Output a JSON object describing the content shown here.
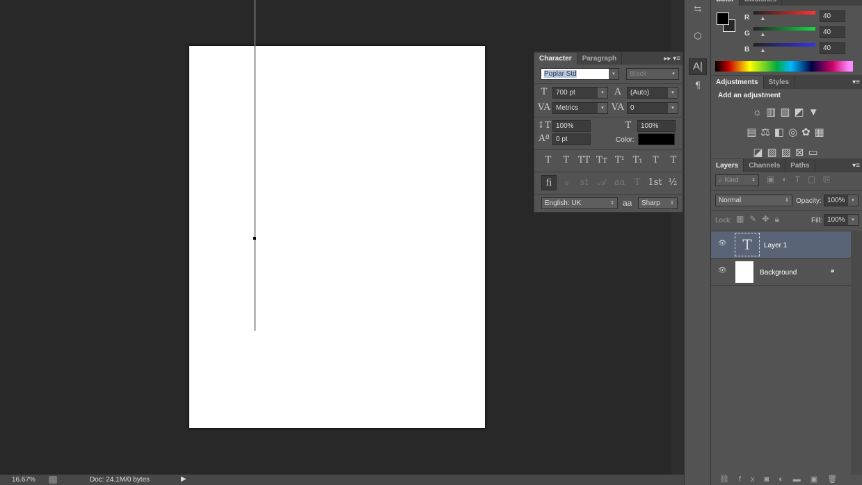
{
  "status": {
    "zoom": "16.67%",
    "doc": "Doc: 24.1M/0 bytes"
  },
  "character": {
    "tabs": [
      "Character",
      "Paragraph"
    ],
    "font_family": "Poplar Std",
    "font_style": "Black",
    "size": "700 pt",
    "leading": "(Auto)",
    "kerning": "Metrics",
    "tracking": "0",
    "vscale": "100%",
    "hscale": "100%",
    "baseline": "0 pt",
    "color_label": "Color:",
    "color": "#000000",
    "language": "English: UK",
    "aa_icon": "aa",
    "antialias": "Sharp",
    "style_buttons": [
      "T",
      "T",
      "TT",
      "Tт",
      "T¹",
      "T₁",
      "T",
      "T"
    ],
    "opentype_buttons": [
      "ﬁ",
      "ℴ",
      "st",
      "𝒜",
      "aa",
      "T",
      "1st",
      "½"
    ]
  },
  "color": {
    "tabs": [
      "Color",
      "Swatches"
    ],
    "channels": [
      {
        "label": "R",
        "value": "40"
      },
      {
        "label": "G",
        "value": "40"
      },
      {
        "label": "B",
        "value": "40"
      }
    ],
    "foreground": "#000000",
    "background": "#282828"
  },
  "adjustments": {
    "tabs": [
      "Adjustments",
      "Styles"
    ],
    "heading": "Add an adjustment"
  },
  "layers": {
    "tabs": [
      "Layers",
      "Channels",
      "Paths"
    ],
    "filter": "Kind",
    "blend_mode": "Normal",
    "opacity_label": "Opacity:",
    "opacity": "100%",
    "lock_label": "Lock:",
    "fill_label": "Fill:",
    "fill": "100%",
    "items": [
      {
        "name": "Layer 1",
        "type": "text",
        "selected": true
      },
      {
        "name": "Background",
        "type": "image",
        "locked": true
      }
    ]
  }
}
